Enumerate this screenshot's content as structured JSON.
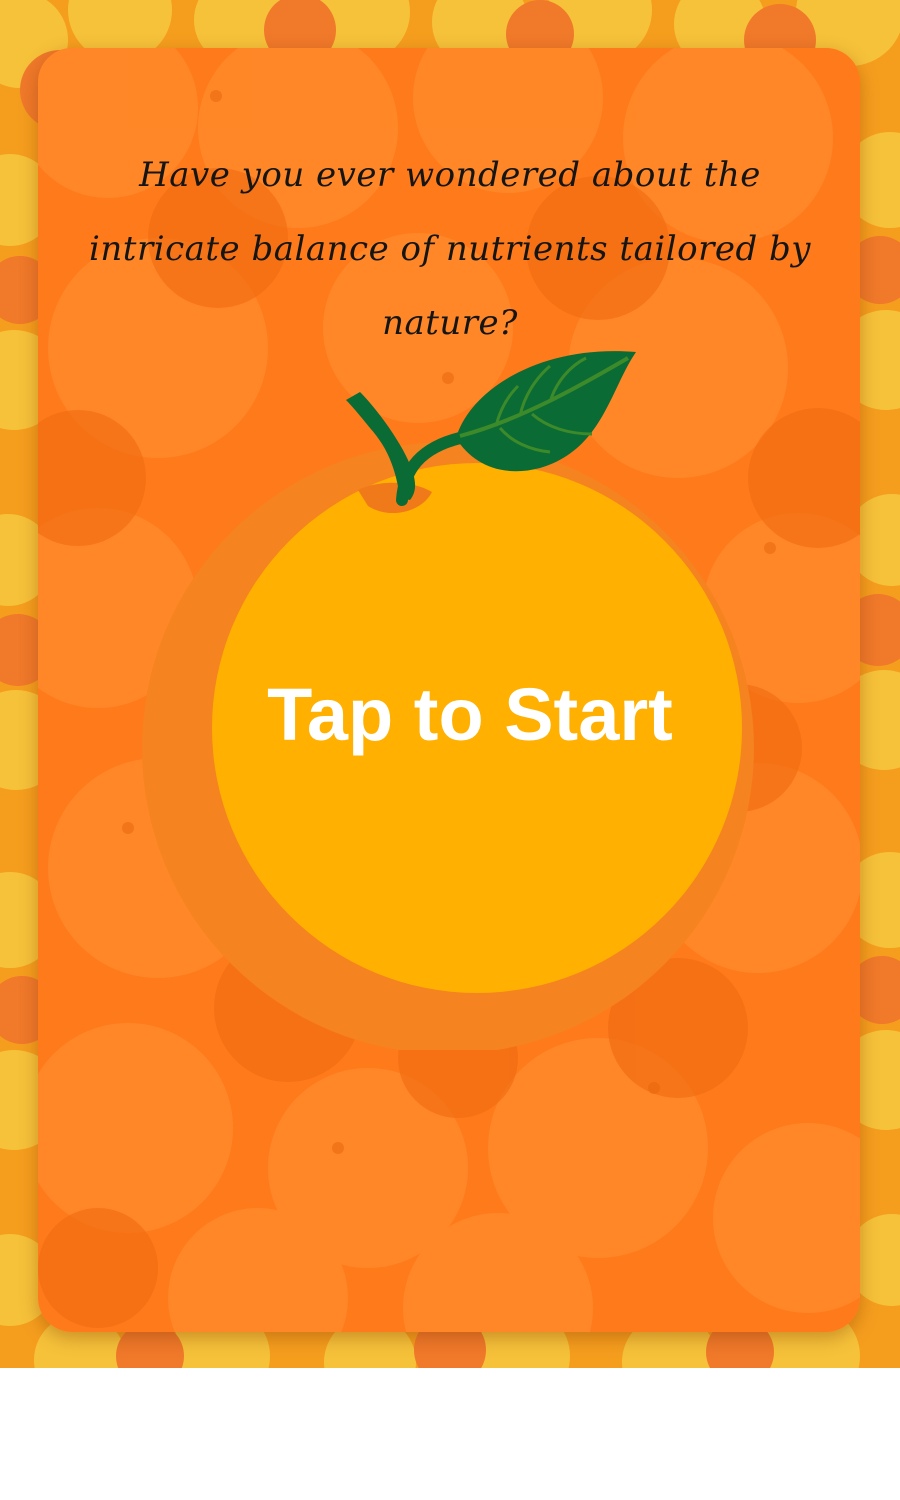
{
  "intro": {
    "question": "Have you ever wondered about the intricate balance of nutrients tailored by nature?"
  },
  "start": {
    "label": "Tap to Start"
  },
  "icons": {
    "background": "fruit-pattern",
    "button": "orange-fruit-icon",
    "leaf": "leaf-icon"
  },
  "colors": {
    "card_orange": "#ff7a1a",
    "frame_yellow": "#f6c23a",
    "orange_body": "#ffb000",
    "orange_rim": "#f5831f",
    "leaf_green": "#0b6b34"
  }
}
